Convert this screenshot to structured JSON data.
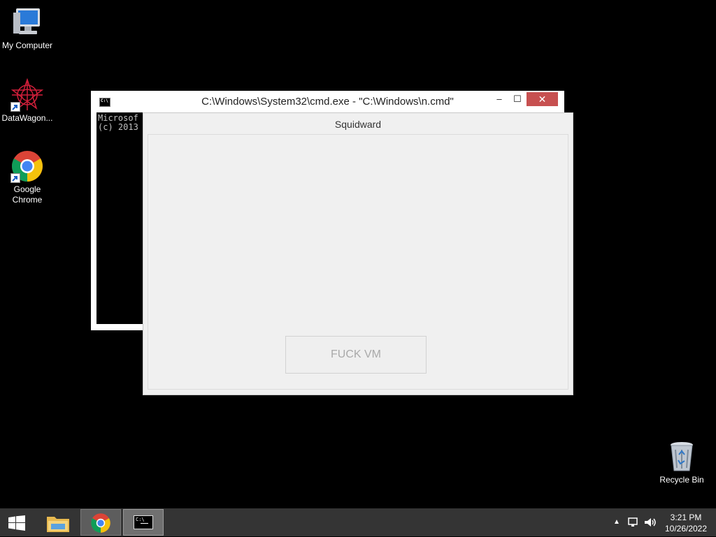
{
  "desktop": {
    "icons": [
      {
        "label": "My Computer",
        "icon": "computer-icon"
      },
      {
        "label": "DataWagon...",
        "icon": "datawagon-icon"
      },
      {
        "label": "Google\nChrome",
        "icon": "chrome-icon"
      }
    ],
    "recycle_bin": {
      "label": "Recycle Bin",
      "icon": "recycle-bin-icon"
    }
  },
  "cmd_window": {
    "title": "C:\\Windows\\System32\\cmd.exe - \"C:\\Windows\\n.cmd\"",
    "icon_text": "C:\\",
    "minimize": "–",
    "maximize": "☐",
    "close": "✕",
    "console_text": "Microsof\n(c) 2013"
  },
  "squidward_window": {
    "title": "Squidward",
    "button_label": "FUCK VM"
  },
  "taskbar": {
    "items": [
      "start-button",
      "file-explorer",
      "google-chrome",
      "command-prompt"
    ],
    "tray": {
      "chevron": "▲",
      "time": "3:21 PM",
      "date": "10/26/2022"
    }
  },
  "colors": {
    "desktop_bg": "#000000",
    "taskbar_bg": "#343434",
    "close_button": "#c75050",
    "dialog_bg": "#f0f0f0"
  }
}
